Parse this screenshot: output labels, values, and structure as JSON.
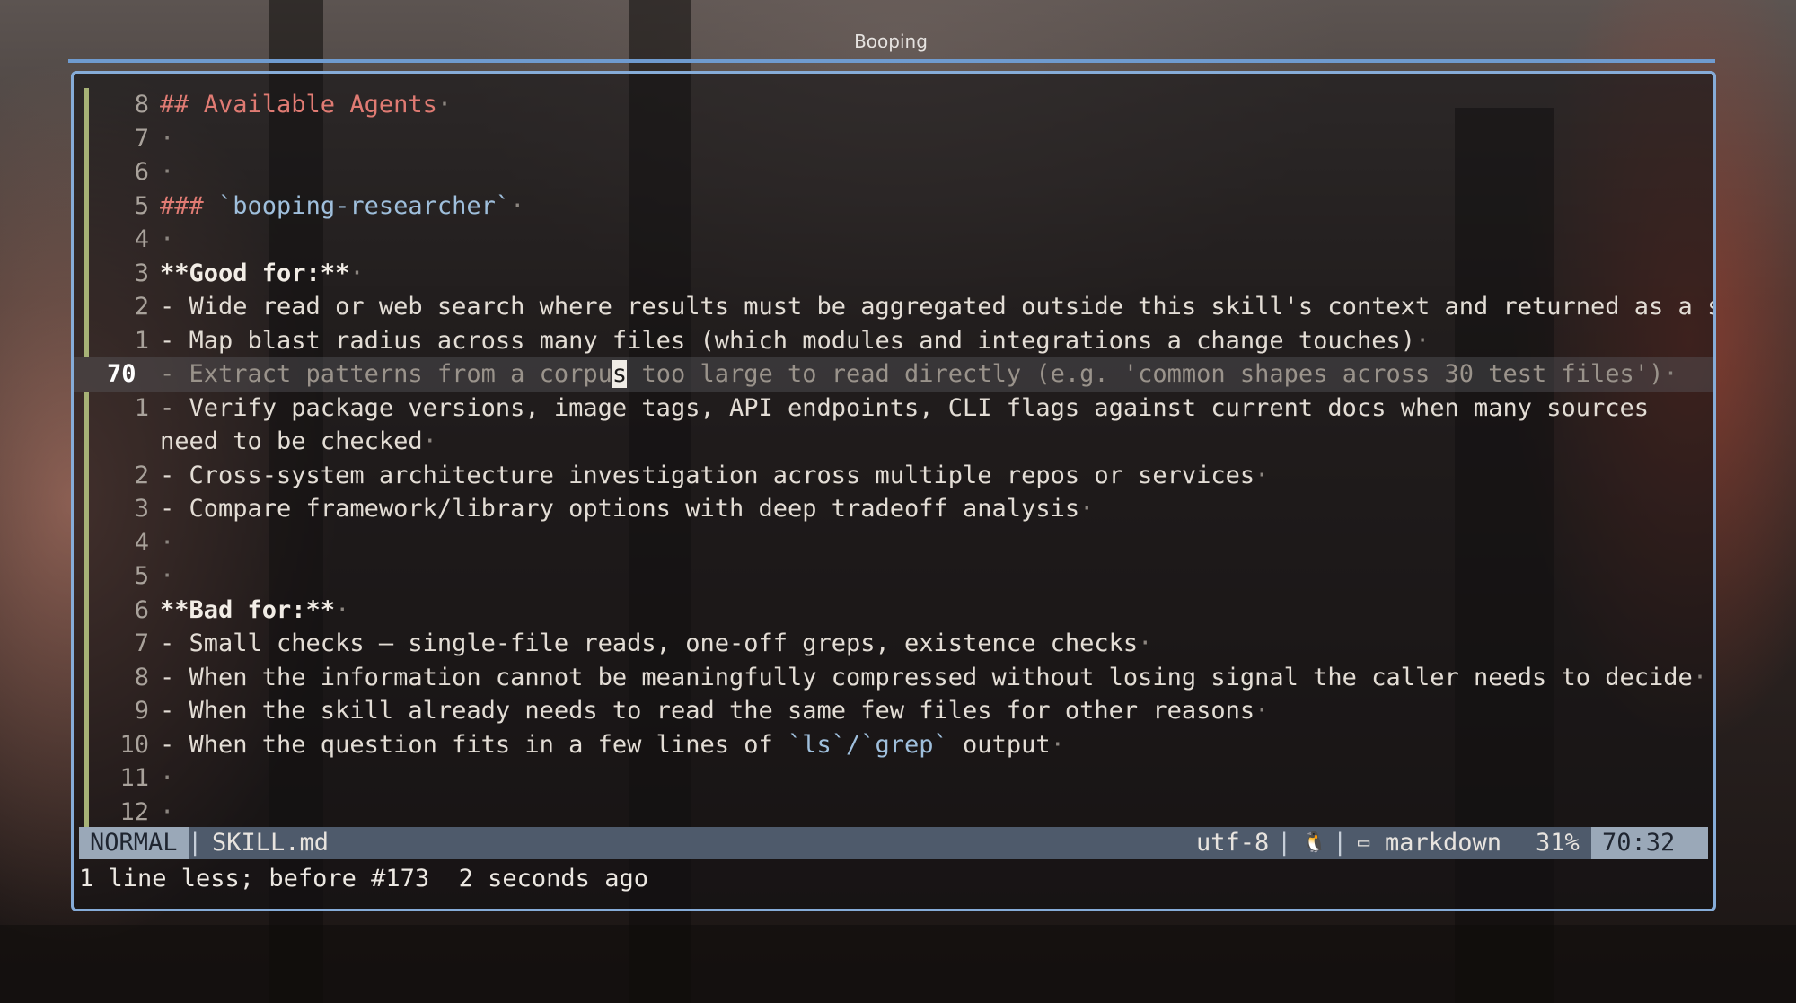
{
  "window": {
    "title": "Booping"
  },
  "editor": {
    "lines": [
      {
        "num": "8",
        "parts": [
          {
            "t": "## Available Agents",
            "c": "heading"
          },
          {
            "t": "·",
            "c": "dot"
          }
        ]
      },
      {
        "num": "7",
        "parts": [
          {
            "t": "·",
            "c": "dot"
          }
        ]
      },
      {
        "num": "6",
        "parts": [
          {
            "t": "·",
            "c": "dot"
          }
        ]
      },
      {
        "num": "5",
        "parts": [
          {
            "t": "### ",
            "c": "heading"
          },
          {
            "t": "`booping-researcher`",
            "c": "codespan"
          },
          {
            "t": "·",
            "c": "dot"
          }
        ]
      },
      {
        "num": "4",
        "parts": [
          {
            "t": "·",
            "c": "dot"
          }
        ]
      },
      {
        "num": "3",
        "parts": [
          {
            "t": "**Good for:**",
            "c": "bold"
          },
          {
            "t": "·",
            "c": "dot"
          }
        ]
      },
      {
        "num": "2",
        "parts": [
          {
            "t": "- Wide read or web search where results must be aggregated outside this skill's context and returned as a summary",
            "c": "text"
          },
          {
            "t": "·",
            "c": "dot"
          }
        ]
      },
      {
        "num": "1",
        "parts": [
          {
            "t": "- Map blast radius across many files (which modules and integrations a change touches)",
            "c": "text"
          },
          {
            "t": "·",
            "c": "dot"
          }
        ]
      },
      {
        "num": "70",
        "current": true,
        "parts": [
          {
            "t": "- Extract patterns from a corpu",
            "c": "muted"
          },
          {
            "t": "s",
            "c": "cursor"
          },
          {
            "t": " too large to read directly (e.g. 'common shapes across 30 test files')",
            "c": "muted"
          },
          {
            "t": "·",
            "c": "dot"
          }
        ]
      },
      {
        "num": "1",
        "wrap": true,
        "parts": [
          {
            "t": "- Verify package versions, image tags, API endpoints, CLI flags against current docs when many sources need to be checked",
            "c": "text"
          },
          {
            "t": "·",
            "c": "dot"
          }
        ]
      },
      {
        "num": "2",
        "parts": [
          {
            "t": "- Cross-system architecture investigation across multiple repos or services",
            "c": "text"
          },
          {
            "t": "·",
            "c": "dot"
          }
        ]
      },
      {
        "num": "3",
        "parts": [
          {
            "t": "- Compare framework/library options with deep tradeoff analysis",
            "c": "text"
          },
          {
            "t": "·",
            "c": "dot"
          }
        ]
      },
      {
        "num": "4",
        "parts": [
          {
            "t": "·",
            "c": "dot"
          }
        ]
      },
      {
        "num": "5",
        "parts": [
          {
            "t": "·",
            "c": "dot"
          }
        ]
      },
      {
        "num": "6",
        "parts": [
          {
            "t": "**Bad for:**",
            "c": "bold"
          },
          {
            "t": "·",
            "c": "dot"
          }
        ]
      },
      {
        "num": "7",
        "parts": [
          {
            "t": "- Small checks — single-file reads, one-off greps, existence checks",
            "c": "text"
          },
          {
            "t": "·",
            "c": "dot"
          }
        ]
      },
      {
        "num": "8",
        "parts": [
          {
            "t": "- When the information cannot be meaningfully compressed without losing signal the caller needs to decide",
            "c": "text"
          },
          {
            "t": "·",
            "c": "dot"
          }
        ]
      },
      {
        "num": "9",
        "parts": [
          {
            "t": "- When the skill already needs to read the same few files for other reasons",
            "c": "text"
          },
          {
            "t": "·",
            "c": "dot"
          }
        ]
      },
      {
        "num": "10",
        "parts": [
          {
            "t": "- When the question fits in a few lines of ",
            "c": "text"
          },
          {
            "t": "`ls`/`grep`",
            "c": "codespan"
          },
          {
            "t": " output",
            "c": "text"
          },
          {
            "t": "·",
            "c": "dot"
          }
        ]
      },
      {
        "num": "11",
        "parts": [
          {
            "t": "·",
            "c": "dot"
          }
        ]
      },
      {
        "num": "12",
        "parts": [
          {
            "t": "·",
            "c": "dot"
          }
        ]
      }
    ]
  },
  "statusline": {
    "mode": "NORMAL",
    "sep": "|",
    "filename": "SKILL.md",
    "encoding": "utf-8",
    "os_glyph": "🐧",
    "filetype_icon": "▭",
    "filetype": "markdown",
    "percent": "31%",
    "position": "70:32"
  },
  "cmdline": {
    "message": "1 line less; before #173  2 seconds ago"
  },
  "colors": {
    "accent": "#86acd8",
    "gutter_mark": "#a7b276",
    "heading": "#e07b73",
    "codespan": "#9fbfdc"
  }
}
